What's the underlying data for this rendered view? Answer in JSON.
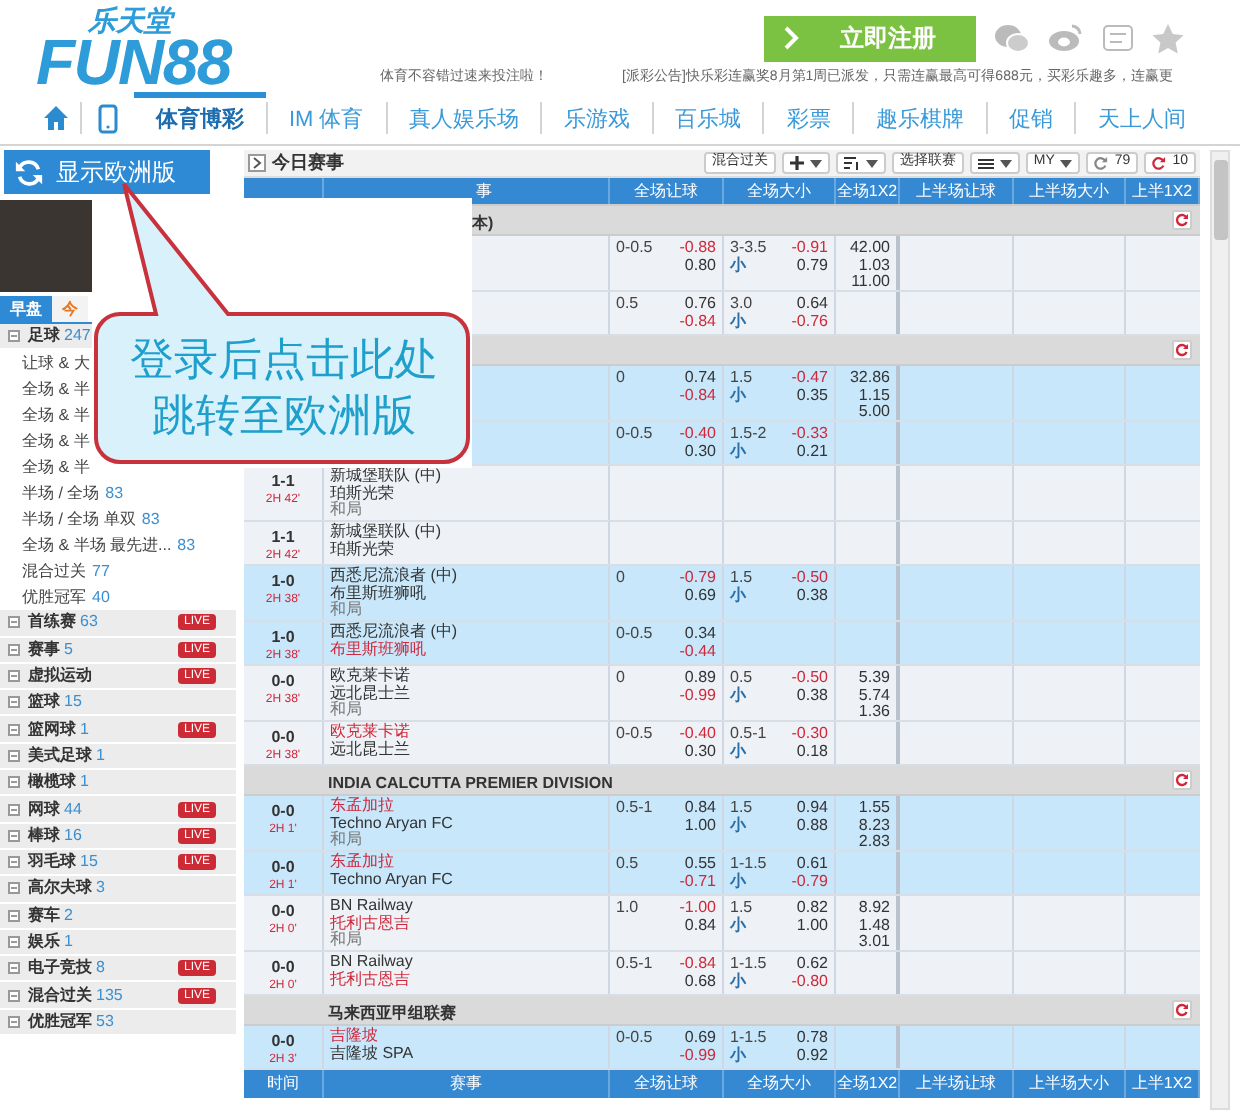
{
  "header": {
    "logo_top": "乐天堂",
    "logo_main": "FUN88",
    "register_button": "立即注册",
    "notice": "体育不容错过速来投注啦！",
    "announcement": "[派彩公告]快乐彩连赢奖8月第1周已派发，只需连赢最高可得688元，买彩乐趣多，连赢更"
  },
  "nav": {
    "tabs": [
      {
        "label": "体育博彩",
        "selected": true
      },
      {
        "label": "IM 体育",
        "selected": false
      },
      {
        "label": "真人娱乐场",
        "selected": false
      },
      {
        "label": "乐游戏",
        "selected": false
      },
      {
        "label": "百乐城",
        "selected": false
      },
      {
        "label": "彩票",
        "selected": false
      },
      {
        "label": "趣乐棋牌",
        "selected": false
      },
      {
        "label": "促销",
        "selected": false
      },
      {
        "label": "天上人间",
        "selected": false
      }
    ]
  },
  "sidebar": {
    "europe_button": "显示欧洲版",
    "tabs": [
      {
        "label": "早盘",
        "selected": true
      },
      {
        "label": "今",
        "selected": false
      }
    ],
    "sports": [
      {
        "name": "足球",
        "count": "247",
        "children": [
          {
            "name": "让球 & 大"
          },
          {
            "name": "全场 & 半"
          },
          {
            "name": "全场 & 半"
          },
          {
            "name": "全场 & 半"
          },
          {
            "name": "全场 & 半"
          },
          {
            "name": "半场 / 全场",
            "count": "83"
          },
          {
            "name": "半场 / 全场 单双",
            "count": "83"
          },
          {
            "name": "全场 & 半场 最先进...",
            "count": "83"
          },
          {
            "name": "混合过关",
            "count": "77"
          },
          {
            "name": "优胜冠军",
            "count": "40"
          }
        ]
      },
      {
        "name": "首练赛",
        "count": "63",
        "badge": "LIVE"
      },
      {
        "name": "赛事",
        "count": "5",
        "badge": "LIVE"
      },
      {
        "name": "虚拟运动",
        "badge": "LIVE"
      },
      {
        "name": "篮球",
        "count": "15"
      },
      {
        "name": "篮网球",
        "count": "1",
        "badge": "LIVE"
      },
      {
        "name": "美式足球",
        "count": "1"
      },
      {
        "name": "橄榄球",
        "count": "1"
      },
      {
        "name": "网球",
        "count": "44",
        "badge": "LIVE"
      },
      {
        "name": "棒球",
        "count": "16",
        "badge": "LIVE"
      },
      {
        "name": "羽毛球",
        "count": "15",
        "badge": "LIVE"
      },
      {
        "name": "高尔夫球",
        "count": "3"
      },
      {
        "name": "赛车",
        "count": "2"
      },
      {
        "name": "娱乐",
        "count": "1"
      },
      {
        "name": "电子竞技",
        "count": "8",
        "badge": "LIVE"
      },
      {
        "name": "混合过关",
        "count": "135",
        "badge": "LIVE"
      },
      {
        "name": "优胜冠军",
        "count": "53"
      }
    ]
  },
  "callout": {
    "lines": [
      "登录后点击此处",
      "跳转至欧洲版"
    ]
  },
  "toolbar": {
    "title": "今日赛事",
    "buttons": [
      {
        "kind": "text",
        "label": "混合过关",
        "dropdown": false
      },
      {
        "kind": "plus",
        "dropdown": true
      },
      {
        "kind": "sort",
        "dropdown": true
      },
      {
        "kind": "text",
        "label": "选择联赛",
        "dropdown": false
      },
      {
        "kind": "list",
        "dropdown": true
      },
      {
        "kind": "text",
        "label": "MY",
        "dropdown": true
      },
      {
        "kind": "refresh",
        "label": "79",
        "color": "#888888",
        "dropdown": false
      },
      {
        "kind": "refresh",
        "label": "10",
        "color": "#d0283a",
        "dropdown": false
      }
    ]
  },
  "table": {
    "columns": [
      {
        "label": "事",
        "clipped": true
      },
      {
        "label": "全场让球"
      },
      {
        "label": "全场大小"
      },
      {
        "label": "全场1X2"
      },
      {
        "label": "上半场让球"
      },
      {
        "label": "上半场大小"
      },
      {
        "label": "上半1X2"
      }
    ],
    "leagues": [
      {
        "name": "本)",
        "clipped": true,
        "rows": [
          {
            "highlighted": false,
            "handicap": {
              "line": "0-0.5",
              "odds": [
                {
                  "value": "-0.88",
                  "red": true
                },
                {
                  "value": "0.80",
                  "red": false
                }
              ]
            },
            "over_under": {
              "line": "3-3.5",
              "side": "小",
              "odds": [
                {
                  "value": "-0.91",
                  "red": true
                },
                {
                  "value": "0.79",
                  "red": false
                }
              ]
            },
            "result_1x2": [
              "42.00",
              "1.03",
              "11.00"
            ]
          },
          {
            "highlighted": false,
            "handicap": {
              "line": "0.5",
              "odds": [
                {
                  "value": "0.76",
                  "red": false
                },
                {
                  "value": "-0.84",
                  "red": true
                }
              ]
            },
            "over_under": {
              "line": "3.0",
              "side": "小",
              "odds": [
                {
                  "value": "0.64",
                  "red": false
                },
                {
                  "value": "-0.76",
                  "red": true
                }
              ]
            }
          }
        ]
      },
      {
        "rows": [
          {
            "highlighted": true,
            "handicap": {
              "line": "0",
              "odds": [
                {
                  "value": "0.74",
                  "red": false
                },
                {
                  "value": "-0.84",
                  "red": true
                }
              ]
            },
            "over_under": {
              "line": "1.5",
              "side": "小",
              "odds": [
                {
                  "value": "-0.47",
                  "red": true
                },
                {
                  "value": "0.35",
                  "red": false
                }
              ]
            },
            "result_1x2": [
              "32.86",
              "1.15",
              "5.00"
            ]
          },
          {
            "highlighted": true,
            "handicap": {
              "line": "0-0.5",
              "odds": [
                {
                  "value": "-0.40",
                  "red": true
                },
                {
                  "value": "0.30",
                  "red": false
                }
              ]
            },
            "over_under": {
              "line": "1.5-2",
              "side": "小",
              "odds": [
                {
                  "value": "-0.33",
                  "red": true
                },
                {
                  "value": "0.21",
                  "red": false
                }
              ]
            }
          },
          {
            "highlighted": false,
            "score": "1-1",
            "clock": "2H 42'",
            "teams": [
              {
                "name": "新城堡联队 (中)",
                "red": false
              },
              {
                "name": "珀斯光荣",
                "red": false
              }
            ],
            "draw": "和局"
          },
          {
            "highlighted": false,
            "score": "1-1",
            "clock": "2H 42'",
            "teams": [
              {
                "name": "新城堡联队 (中)",
                "red": false
              },
              {
                "name": "珀斯光荣",
                "red": false
              }
            ]
          },
          {
            "highlighted": true,
            "score": "1-0",
            "clock": "2H 38'",
            "teams": [
              {
                "name": "西悉尼流浪者 (中)",
                "red": false
              },
              {
                "name": "布里斯班狮吼",
                "red": false
              }
            ],
            "draw": "和局",
            "handicap": {
              "line": "0",
              "odds": [
                {
                  "value": "-0.79",
                  "red": true
                },
                {
                  "value": "0.69",
                  "red": false
                }
              ]
            },
            "over_under": {
              "line": "1.5",
              "side": "小",
              "odds": [
                {
                  "value": "-0.50",
                  "red": true
                },
                {
                  "value": "0.38",
                  "red": false
                }
              ]
            }
          },
          {
            "highlighted": true,
            "score": "1-0",
            "clock": "2H 38'",
            "teams": [
              {
                "name": "西悉尼流浪者 (中)",
                "red": false
              },
              {
                "name": "布里斯班狮吼",
                "red": true
              }
            ],
            "handicap": {
              "line": "0-0.5",
              "odds": [
                {
                  "value": "0.34",
                  "red": false
                },
                {
                  "value": "-0.44",
                  "red": true
                }
              ]
            }
          },
          {
            "highlighted": false,
            "score": "0-0",
            "clock": "2H 38'",
            "teams": [
              {
                "name": "欧克莱卡诺",
                "red": false
              },
              {
                "name": "远北昆士兰",
                "red": false
              }
            ],
            "draw": "和局",
            "handicap": {
              "line": "0",
              "odds": [
                {
                  "value": "0.89",
                  "red": false
                },
                {
                  "value": "-0.99",
                  "red": true
                }
              ]
            },
            "over_under": {
              "line": "0.5",
              "side": "小",
              "odds": [
                {
                  "value": "-0.50",
                  "red": true
                },
                {
                  "value": "0.38",
                  "red": false
                }
              ]
            },
            "result_1x2": [
              "5.39",
              "5.74",
              "1.36"
            ]
          },
          {
            "highlighted": false,
            "score": "0-0",
            "clock": "2H 38'",
            "teams": [
              {
                "name": "欧克莱卡诺",
                "red": true
              },
              {
                "name": "远北昆士兰",
                "red": false
              }
            ],
            "handicap": {
              "line": "0-0.5",
              "odds": [
                {
                  "value": "-0.40",
                  "red": true
                },
                {
                  "value": "0.30",
                  "red": false
                }
              ]
            },
            "over_under": {
              "line": "0.5-1",
              "side": "小",
              "odds": [
                {
                  "value": "-0.30",
                  "red": true
                },
                {
                  "value": "0.18",
                  "red": false
                }
              ]
            }
          }
        ]
      },
      {
        "name": "INDIA CALCUTTA PREMIER DIVISION",
        "rows": [
          {
            "highlighted": true,
            "score": "0-0",
            "clock": "2H 1'",
            "teams": [
              {
                "name": "东孟加拉",
                "red": true
              },
              {
                "name": "Techno Aryan FC",
                "red": false
              }
            ],
            "draw": "和局",
            "handicap": {
              "line": "0.5-1",
              "odds": [
                {
                  "value": "0.84",
                  "red": false
                },
                {
                  "value": "1.00",
                  "red": false
                }
              ]
            },
            "over_under": {
              "line": "1.5",
              "side": "小",
              "odds": [
                {
                  "value": "0.94",
                  "red": false
                },
                {
                  "value": "0.88",
                  "red": false
                }
              ]
            },
            "result_1x2": [
              "1.55",
              "8.23",
              "2.83"
            ]
          },
          {
            "highlighted": true,
            "score": "0-0",
            "clock": "2H 1'",
            "teams": [
              {
                "name": "东孟加拉",
                "red": true
              },
              {
                "name": "Techno Aryan FC",
                "red": false
              }
            ],
            "handicap": {
              "line": "0.5",
              "odds": [
                {
                  "value": "0.55",
                  "red": false
                },
                {
                  "value": "-0.71",
                  "red": true
                }
              ]
            },
            "over_under": {
              "line": "1-1.5",
              "side": "小",
              "odds": [
                {
                  "value": "0.61",
                  "red": false
                },
                {
                  "value": "-0.79",
                  "red": true
                }
              ]
            }
          },
          {
            "highlighted": false,
            "score": "0-0",
            "clock": "2H 0'",
            "teams": [
              {
                "name": "BN Railway",
                "red": false
              },
              {
                "name": "托利古恩吉",
                "red": true
              }
            ],
            "draw": "和局",
            "handicap": {
              "line": "1.0",
              "odds": [
                {
                  "value": "-1.00",
                  "red": true
                },
                {
                  "value": "0.84",
                  "red": false
                }
              ]
            },
            "over_under": {
              "line": "1.5",
              "side": "小",
              "odds": [
                {
                  "value": "0.82",
                  "red": false
                },
                {
                  "value": "1.00",
                  "red": false
                }
              ]
            },
            "result_1x2": [
              "8.92",
              "1.48",
              "3.01"
            ]
          },
          {
            "highlighted": false,
            "score": "0-0",
            "clock": "2H 0'",
            "teams": [
              {
                "name": "BN Railway",
                "red": false
              },
              {
                "name": "托利古恩吉",
                "red": true
              }
            ],
            "handicap": {
              "line": "0.5-1",
              "odds": [
                {
                  "value": "-0.84",
                  "red": true
                },
                {
                  "value": "0.68",
                  "red": false
                }
              ]
            },
            "over_under": {
              "line": "1-1.5",
              "side": "小",
              "odds": [
                {
                  "value": "0.62",
                  "red": false
                },
                {
                  "value": "-0.80",
                  "red": true
                }
              ]
            }
          }
        ]
      },
      {
        "name": "马来西亚甲组联赛",
        "rows": [
          {
            "highlighted": true,
            "score": "0-0",
            "clock": "2H 3'",
            "teams": [
              {
                "name": "吉隆坡",
                "red": true
              },
              {
                "name": "吉隆坡 SPA",
                "red": false
              }
            ],
            "handicap": {
              "line": "0-0.5",
              "odds": [
                {
                  "value": "0.69",
                  "red": false
                },
                {
                  "value": "-0.99",
                  "red": true
                }
              ]
            },
            "over_under": {
              "line": "1-1.5",
              "side": "小",
              "odds": [
                {
                  "value": "0.78",
                  "red": false
                },
                {
                  "value": "0.92",
                  "red": false
                }
              ]
            }
          }
        ]
      }
    ],
    "footer_columns": [
      "时间",
      "赛事",
      "全场让球",
      "全场大小",
      "全场1X2",
      "上半场让球",
      "上半场大小",
      "上半1X2"
    ]
  }
}
